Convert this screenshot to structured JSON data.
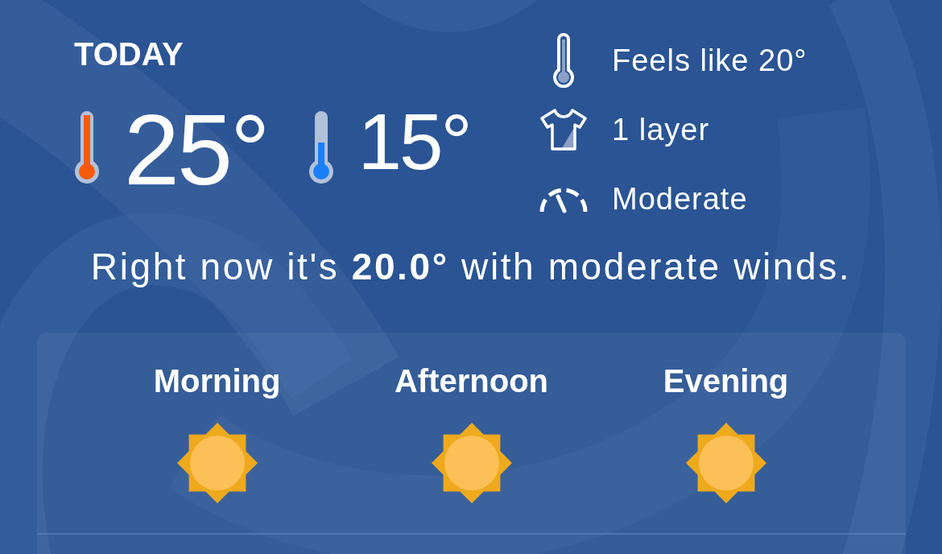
{
  "header": {
    "title": "TODAY"
  },
  "temperatures": [
    {
      "kind": "high",
      "value": "25°"
    },
    {
      "kind": "low",
      "value": "15°"
    }
  ],
  "details": [
    {
      "kind": "feels_like",
      "text": "Feels like 20°"
    },
    {
      "kind": "clothing",
      "text": "1 layer"
    },
    {
      "kind": "wind",
      "text": "Moderate"
    }
  ],
  "summary": "Right now it's **20.0°** with moderate winds.",
  "periods": [
    {
      "label": "Morning",
      "kind": "sunny"
    },
    {
      "label": "Afternoon",
      "kind": "sunny"
    },
    {
      "label": "Evening",
      "kind": "sunny"
    }
  ]
}
